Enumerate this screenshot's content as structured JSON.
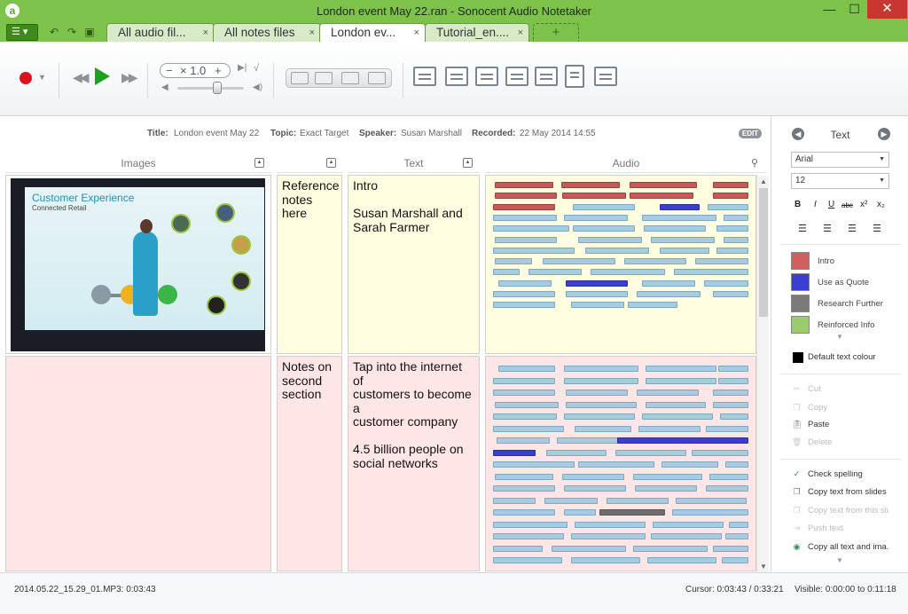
{
  "app": {
    "window_title": "London event May 22.ran - Sonocent Audio Notetaker",
    "logo_glyph": "a"
  },
  "window_controls": {
    "minimize": "—",
    "maximize": "☐",
    "close": "✕"
  },
  "tabs": [
    {
      "label": "All audio fil...",
      "close": "×",
      "active": false
    },
    {
      "label": "All notes files",
      "close": "×",
      "active": false
    },
    {
      "label": "London ev...",
      "close": "×",
      "active": true
    },
    {
      "label": "Tutorial_en....",
      "close": "×",
      "active": false
    }
  ],
  "new_tab_label": "+",
  "toolbar": {
    "speed": {
      "minus": "−",
      "times": "× 1.0",
      "plus": "+"
    },
    "icons": [
      "record-icon",
      "rewind-icon",
      "play-icon",
      "fast-forward-icon",
      "speed-icon",
      "volume-icon",
      "view-icons",
      "insert-section-icon",
      "move-icon",
      "save-section-icon",
      "export-icon",
      "presentation-icon",
      "document-icon",
      "camera-icon"
    ]
  },
  "meta": {
    "title_label": "Title:",
    "title_value": "London event May 22",
    "topic_label": "Topic:",
    "topic_value": "Exact Target",
    "speaker_label": "Speaker:",
    "speaker_value": "Susan Marshall",
    "recorded_label": "Recorded:",
    "recorded_value": "22 May 2014 14:55",
    "edit_label": "EDIT"
  },
  "columns": {
    "images": "Images",
    "text": "Text",
    "audio": "Audio"
  },
  "sections": [
    {
      "notes": "Reference\nnotes here",
      "text": "Intro\n\nSusan Marshall and\nSarah Farmer",
      "slide": {
        "title": "Customer Experience",
        "subtitle": "Connected Retail"
      }
    },
    {
      "notes": "Notes on\nsecond\nsection",
      "text": "Tap into the internet of\ncustomers to become a\ncustomer company\n\n4.5 billion people on\nsocial networks"
    }
  ],
  "right_panel": {
    "title": "Text",
    "font": "Arial",
    "size": "12",
    "format_buttons": [
      "B",
      "I",
      "U",
      "abc",
      "x²",
      "x₂"
    ],
    "categories": [
      {
        "label": "Intro",
        "color": "#d06060"
      },
      {
        "label": "Use as Quote",
        "color": "#3a3fcf"
      },
      {
        "label": "Research Further",
        "color": "#7a7a7a"
      },
      {
        "label": "Reinforced Info",
        "color": "#9ccc6a"
      }
    ],
    "default_colour_label": "Default text colour",
    "edit_actions": [
      {
        "label": "Cut",
        "enabled": false
      },
      {
        "label": "Copy",
        "enabled": false
      },
      {
        "label": "Paste",
        "enabled": true
      },
      {
        "label": "Delete",
        "enabled": false
      }
    ],
    "text_actions": [
      {
        "label": "Check spelling",
        "enabled": true
      },
      {
        "label": "Copy text from slides",
        "enabled": true
      },
      {
        "label": "Copy text from this sli...",
        "enabled": false
      },
      {
        "label": "Push text",
        "enabled": false
      },
      {
        "label": "Copy all text and ima...",
        "enabled": true
      }
    ]
  },
  "status": {
    "file": "2014.05.22_15.29_01.MP3: 0:03:43",
    "cursor": "Cursor:  0:03:43 / 0:33:21",
    "visible": "Visible:  0:00:00 to 0:11:18"
  },
  "colors": {
    "titlebar": "#7dc24b",
    "section1_bg": "#fffde0",
    "section2_bg": "#ffe6e6",
    "intro_bar": "#c45a5a",
    "audio_bar": "#a7cbdf",
    "quote_bar": "#3a3fcf",
    "research_bar": "#6e6e6e"
  }
}
